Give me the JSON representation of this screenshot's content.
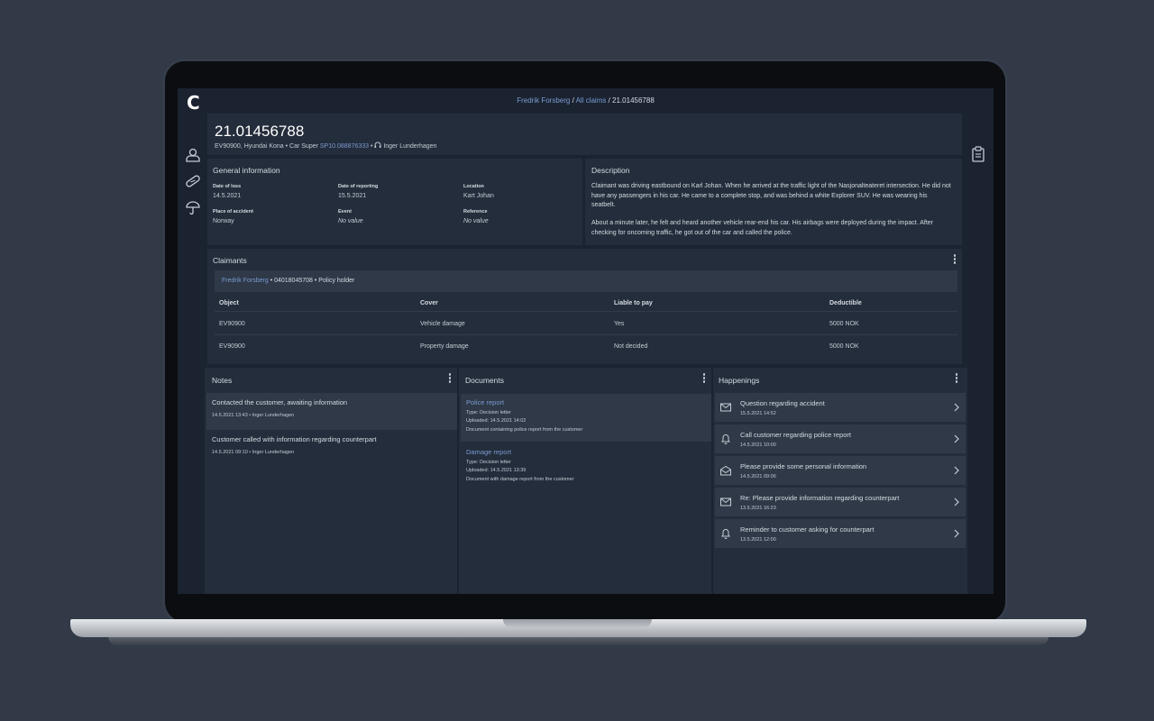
{
  "app": {
    "logo": "C"
  },
  "breadcrumb": {
    "part1": "Fredrik Forsberg",
    "sep1": " / ",
    "part2": "All claims",
    "sep2": " / ",
    "current": "21.01456788"
  },
  "claim": {
    "number": "21.01456788",
    "vehicle": "EV90900, Hyundai Kona",
    "product": "Car Super",
    "policy": "SP10.088876333",
    "handler": "Inger Lunderhagen"
  },
  "general": {
    "title": "General information",
    "fields": [
      {
        "label": "Date of loss",
        "value": "14.5.2021",
        "italic": false
      },
      {
        "label": "Date of reporting",
        "value": "15.5.2021",
        "italic": false
      },
      {
        "label": "Location",
        "value": "Kart Johan",
        "italic": false
      },
      {
        "label": "Place of accident",
        "value": "Norway",
        "italic": false
      },
      {
        "label": "Event",
        "value": "No value",
        "italic": true
      },
      {
        "label": "Reference",
        "value": "No value",
        "italic": true
      }
    ]
  },
  "description": {
    "title": "Description",
    "p1": "Claimant was driving eastbound on Karl Johan. When he arrived at the traffic light of the Nasjonalteateret intersection. He did not have any passengers in his car. He came to a complete stop, and was behind a white Explorer SUV. He was wearing his seatbelt.",
    "p2": "About a minute later, he felt and heard another vehicle rear-end his car. His airbags were deployed during the impact. After checking for oncoming traffic, he got out of the car and called the police."
  },
  "claimants": {
    "title": "Claimants",
    "name": "Fredrik Forsberg",
    "id": "04018045708",
    "role": "Policy holder",
    "columns": [
      "Object",
      "Cover",
      "Liable to pay",
      "Deductible"
    ],
    "rows": [
      [
        "EV90900",
        "Vehicle damage",
        "Yes",
        "5000 NOK"
      ],
      [
        "EV90900",
        "Property damage",
        "Not decided",
        "5000 NOK"
      ]
    ]
  },
  "notes": {
    "title": "Notes",
    "items": [
      {
        "text": "Contacted the customer, awaiting information",
        "date": "14.5.2021 13:43",
        "author": "Inger Lunderhagen"
      },
      {
        "text": "Customer called with information regarding counterpart",
        "date": "14.5.2021 09:10",
        "author": "Inger Lunderhagen"
      }
    ]
  },
  "documents": {
    "title": "Documents",
    "items": [
      {
        "title": "Police report",
        "type": "Type: Decision letter",
        "uploaded": "Uploaded: 14.5.2021 14:02",
        "desc": "Document containing police report from the customer"
      },
      {
        "title": "Damage report",
        "type": "Type: Decision letter",
        "uploaded": "Uploaded: 14.5.2021 13:39",
        "desc": "Document with damage report from the customer"
      }
    ]
  },
  "happenings": {
    "title": "Happenings",
    "items": [
      {
        "icon": "mail-icon",
        "title": "Question regarding accident",
        "date": "15.5.2021 14:52"
      },
      {
        "icon": "bell-icon",
        "title": "Call customer regarding police report",
        "date": "14.5.2021 10:00"
      },
      {
        "icon": "mail-open-icon",
        "title": "Please provide some personal information",
        "date": "14.5.2021 09:06"
      },
      {
        "icon": "mail-icon",
        "title": "Re: Please provide information regarding counterpart",
        "date": "13.5.2021 16:23"
      },
      {
        "icon": "bell-icon",
        "title": "Reminder to customer asking for counterpart",
        "date": "13.5.2021 12:00"
      }
    ]
  },
  "colors": {
    "screen_bg": "#1b2331",
    "panel_bg": "#242d3b",
    "link": "#7a9ad1",
    "page_bg": "#323a48"
  }
}
